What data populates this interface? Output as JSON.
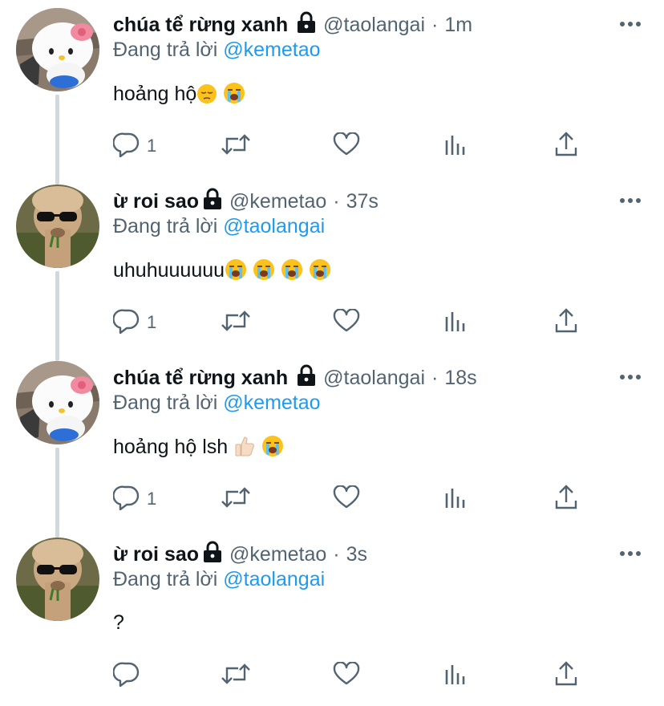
{
  "tweets": [
    {
      "display_name": "chúa tể rừng xanh",
      "handle": "@taolangai",
      "separator": "·",
      "time": "1m",
      "reply_prefix": "Đang trả lời",
      "reply_to": "@kemetao",
      "text": "hoảng hộ",
      "emojis": [
        "pensive-face",
        "loudly-crying-face"
      ],
      "reply_count": "1",
      "avatar": "hello-kitty-plush-avatar"
    },
    {
      "display_name": "ừ roi sao",
      "handle": "@kemetao",
      "separator": "·",
      "time": "37s",
      "reply_prefix": "Đang trả lời",
      "reply_to": "@taolangai",
      "text": "uhuhuuuuuu",
      "emojis": [
        "loudly-crying-face",
        "loudly-crying-face",
        "loudly-crying-face",
        "loudly-crying-face"
      ],
      "reply_count": "1",
      "avatar": "alpaca-sunglasses-avatar"
    },
    {
      "display_name": "chúa tể rừng xanh",
      "handle": "@taolangai",
      "separator": "·",
      "time": "18s",
      "reply_prefix": "Đang trả lời",
      "reply_to": "@kemetao",
      "text": "hoảng hộ lsh ",
      "emojis": [
        "thumbs-up-light-skin",
        "loudly-crying-face"
      ],
      "reply_count": "1",
      "avatar": "hello-kitty-plush-avatar"
    },
    {
      "display_name": "ừ roi sao",
      "handle": "@kemetao",
      "separator": "·",
      "time": "3s",
      "reply_prefix": "Đang trả lời",
      "reply_to": "@taolangai",
      "text": "?",
      "emojis": [],
      "reply_count": "",
      "avatar": "alpaca-sunglasses-avatar"
    }
  ],
  "icons": {
    "lock": "lock-icon",
    "more": "more-dots-icon",
    "reply": "reply-bubble-icon",
    "retweet": "retweet-icon",
    "like": "heart-icon",
    "analytics": "analytics-bars-icon",
    "share": "share-upload-icon"
  },
  "colors": {
    "text": "#0f1419",
    "secondary": "#536471",
    "link": "#1d9bf0",
    "thread_line": "#cfd9de"
  }
}
